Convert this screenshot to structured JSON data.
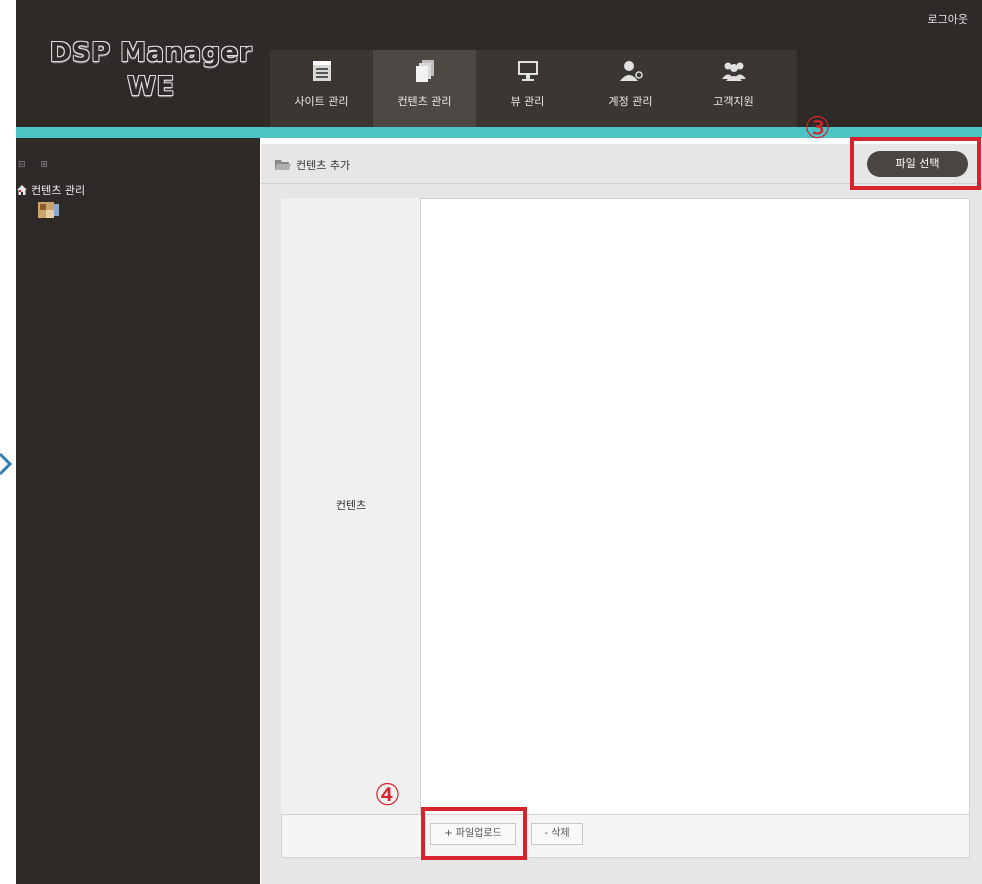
{
  "app": {
    "logo_line1": "DSP Manager",
    "logo_line2": "WE",
    "logout": "로그아웃"
  },
  "nav": {
    "tabs": [
      {
        "label": "사이트 관리",
        "icon": "calendar-icon",
        "active": false
      },
      {
        "label": "컨텐츠 관리",
        "icon": "documents-icon",
        "active": true
      },
      {
        "label": "뷰 관리",
        "icon": "monitor-icon",
        "active": false
      },
      {
        "label": "계정 관리",
        "icon": "user-icon",
        "active": false
      },
      {
        "label": "고객지원",
        "icon": "group-icon",
        "active": false
      }
    ]
  },
  "sidebar": {
    "controls": "⊟ ⊞",
    "tree_root": "컨텐츠 관리",
    "tree_root_icon": "home-icon",
    "tree_child_icon": "image-icon"
  },
  "panel": {
    "title": "컨텐츠 추가",
    "title_icon": "folder-open-icon",
    "select_file_button": "파일 선택",
    "row_label": "컨텐츠",
    "upload_button": "+ 파일업로드",
    "delete_button": "- 삭제"
  },
  "callouts": {
    "step3": "③",
    "step4": "④"
  },
  "colors": {
    "header_bg": "#2d2a27",
    "accent_teal": "#4cc3c5",
    "callout_red": "#d6232c"
  }
}
